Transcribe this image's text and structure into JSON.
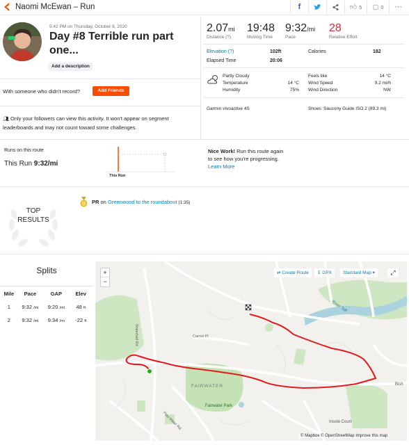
{
  "header": {
    "title": "Naomi McEwan – Run",
    "kudos_count": "5",
    "comment_count": "0"
  },
  "activity": {
    "datetime": "5:42 PM on Thursday, October 8, 2020",
    "title_line1": "Day #8 Terrible run part",
    "title_line2": "one...",
    "add_description": "Add a description",
    "with_someone": "With someone who didn't record?",
    "add_friends": "Add Friends",
    "privacy_note_line1": "Only your followers can view this activity. It won't appear on segment",
    "privacy_note_line2": "leaderboards and may not count toward some challenges."
  },
  "stats": {
    "distance": {
      "value": "2.07",
      "unit": "mi",
      "label": "Distance (?)"
    },
    "moving_time": {
      "value": "19:48",
      "label": "Moving Time"
    },
    "pace": {
      "value": "9:32",
      "unit": "/mi",
      "label": "Pace"
    },
    "relative_effort": {
      "value": "28",
      "label": "Relative Effort"
    },
    "elevation_label": "Elevation (?)",
    "elevation_value": "102ft",
    "calories_label": "Calories",
    "calories_value": "182",
    "elapsed_label": "Elapsed Time",
    "elapsed_value": "20:06"
  },
  "weather": {
    "condition": "Partly Cloudy",
    "temperature_label": "Temperature",
    "temperature_value": "14 °C",
    "humidity_label": "Humidity",
    "humidity_value": "75%",
    "feels_like_label": "Feels like",
    "feels_like_value": "14 °C",
    "wind_speed_label": "Wind Speed",
    "wind_speed_value": "9.2 mi/h",
    "wind_dir_label": "Wind Direction",
    "wind_dir_value": "NW"
  },
  "gear": {
    "device": "Garmin vívoactive 4S",
    "shoes": "Shoes: Saucony Guide ISO 2 (89.3 mi)"
  },
  "route_compare": {
    "heading": "Runs on this route",
    "this_run_label": "This Run",
    "this_run_value": "9:32/mi",
    "graph_label": "This Run",
    "nice_work_bold": "Nice Work!",
    "nice_work_rest": " Run this route again",
    "nice_work_line2": "to see how you're progressing.",
    "learn_more": "Learn More"
  },
  "top_results": {
    "label_line1": "TOP",
    "label_line2": "RESULTS",
    "pr_prefix": "PR",
    "pr_on": " on ",
    "segment": "Greenwood to the roundabout",
    "segment_time": " (1:35)"
  },
  "splits": {
    "title": "Splits",
    "columns": [
      "Mile",
      "Pace",
      "GAP",
      "Elev"
    ],
    "rows": [
      {
        "mile": "1",
        "pace": "9:32",
        "pace_unit": "/mi",
        "gap": "9:20",
        "gap_unit": "/mi",
        "elev": "48",
        "elev_unit": "ft"
      },
      {
        "mile": "2",
        "pace": "9:32",
        "pace_unit": "/mi",
        "gap": "9:34",
        "gap_unit": "/mi",
        "elev": "-22",
        "elev_unit": "ft"
      }
    ]
  },
  "map": {
    "zoom_in": "+",
    "zoom_out": "−",
    "create_route": "Create Route",
    "gpx": "GPX",
    "map_type": "Standard Map",
    "attribution": "© Mapbox © OpenStreetMap Improve this map",
    "labels": {
      "fairwater": "FAIRWATER",
      "fairwater_park": "Fairwater Park",
      "insole_court": "Insole Court",
      "river_taff": "River Taff",
      "waterhall_rd": "Waterhall Rd",
      "plas_mawr_rd": "Plas-Mawr Rd",
      "carnoi_pl": "Carnoi Pl",
      "bish": "Bish"
    },
    "route_color": "#e31a1c"
  },
  "colors": {
    "brand": "#fc4c02",
    "link": "#007fb6"
  }
}
